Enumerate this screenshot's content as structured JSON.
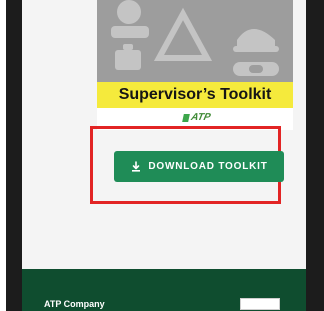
{
  "toolkit": {
    "title": "Supervisor’s Toolkit",
    "brand_logo_text": "ATP",
    "download_label": "DOWNLOAD TOOLKIT",
    "download_icon": "download-icon"
  },
  "footer": {
    "text": "ATP Company"
  },
  "colors": {
    "accent_green": "#1f8c57",
    "footer_green": "#0f4d2f",
    "highlight_red": "#e22424",
    "title_band": "#f5ea3c"
  }
}
